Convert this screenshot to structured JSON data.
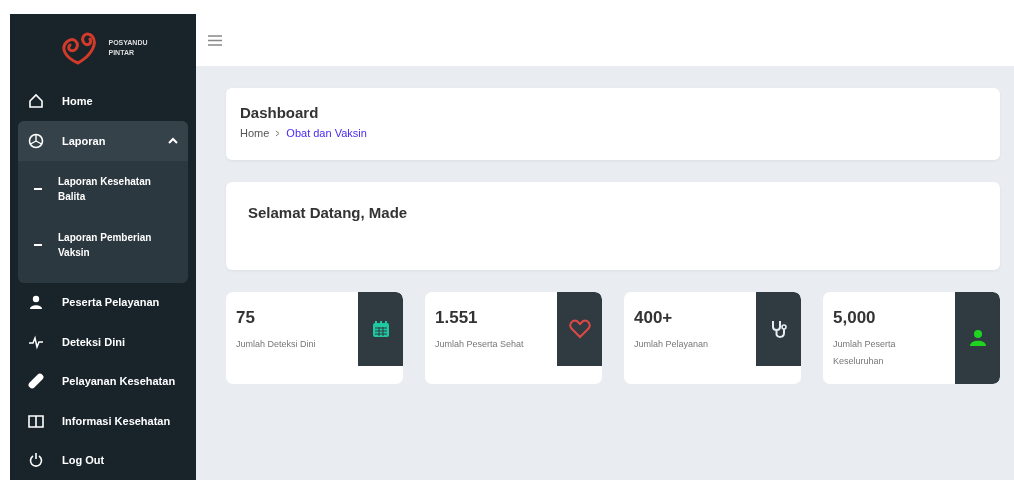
{
  "logo": {
    "line_1": "POSYANDU",
    "line_2": "PINTAR"
  },
  "sidebar": {
    "items": [
      {
        "label": "Home",
        "kind": "home"
      },
      {
        "label": "Laporan",
        "expanded": true,
        "children": [
          {
            "label": "Laporan Kesehatan Balita"
          },
          {
            "label": "Laporan Pemberian Vaksin"
          }
        ]
      },
      {
        "label": "Peserta Pelayanan",
        "kind": "user"
      },
      {
        "label": "Deteksi Dini",
        "kind": "pulse"
      },
      {
        "label": "Pelayanan Kesehatan",
        "kind": "bandage"
      },
      {
        "label": "Informasi Kesehatan",
        "kind": "book"
      },
      {
        "label": "Log Out",
        "kind": "logout"
      }
    ]
  },
  "header": {
    "title": "Dashboard",
    "breadcrumb": [
      "Home",
      "Obat dan Vaksin"
    ]
  },
  "welcome": "Selamat Datang, Made",
  "stats": [
    {
      "value": "75",
      "label": "Jumlah Deteksi Dini",
      "kind": "calendar",
      "color": "#1fc8a0",
      "tall": false
    },
    {
      "value": "1.551",
      "label": "Jumlah Peserta Sehat",
      "kind": "heart",
      "color": "#e04848",
      "tall": false
    },
    {
      "value": "400+",
      "label": "Jumlah Pelayanan",
      "kind": "stethoscope",
      "color": "#e8eef0",
      "tall": false
    },
    {
      "value": "5,000",
      "label": "Jumlah Peserta Keseluruhan",
      "kind": "user",
      "color": "#1ed41e",
      "tall": true
    }
  ]
}
